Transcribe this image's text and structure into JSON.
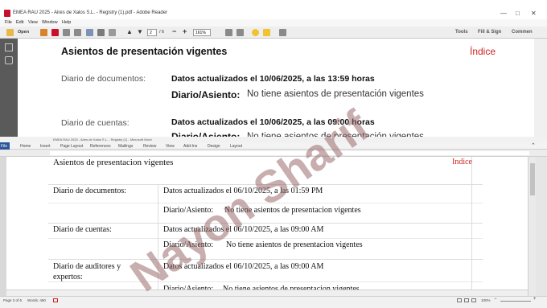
{
  "reader": {
    "title": "EMEA RAU 2025 - Aires de Xalos S.L. - Registry (1).pdf - Adobe Reader",
    "menu": [
      "File",
      "Edit",
      "View",
      "Window",
      "Help"
    ],
    "toolbar": {
      "open_label": "Open",
      "page_current": "2",
      "page_total": "/ 6",
      "zoom": "161%",
      "right_items": [
        "Tools",
        "Fill & Sign",
        "Commen"
      ]
    },
    "page": {
      "title": "Asientos de presentación vigentes",
      "index_link": "Índice",
      "row1_label": "Diario de documentos:",
      "row1_updated": "Datos actualizados el 10/06/2025, a las 13:59 horas",
      "row1_diario": "Diario/Asiento:",
      "row1_status": "No tiene asientos de presentación vigentes",
      "row2_label": "Diario de cuentas:",
      "row2_updated": "Datos actualizados el 10/06/2025, a las 09:00 horas",
      "row2_diario": "Diario/Asiento:",
      "row2_status": "No tiene asientos de presentación vigentes"
    }
  },
  "word": {
    "title_left": "EMEA RAU 2025 - Aires de Xalos S.L. - Registry (1) - Microsoft Word",
    "ribbon": [
      "File",
      "Home",
      "Insert",
      "Page Layout",
      "References",
      "Mailings",
      "Review",
      "View",
      "Add-Ins",
      "Design",
      "Layout"
    ],
    "doc": {
      "title": "Asientos de presentacion vigentes",
      "index_link": "Indice",
      "row1_label": "Diario de documentos:",
      "row1_updated": "Datos actualizados el 06/10/2025, a las 01:59 PM",
      "row1_diario": "Diario/Asiento:",
      "row1_status": "No tiene asientos de presentacion vigentes",
      "row2_label": "Diario de cuentas:",
      "row2_updated": "Datos actualizados el 06/10/2025, a las 09:00 AM",
      "row2_diario": "Diario/Asiento:",
      "row2_status": "No tiene asientos de presentacion vigentes",
      "row3_label_line1": "Diario de auditores y",
      "row3_label_line2": "expertos:",
      "row3_updated": "Datos actualizados el 06/10/2025, a las 09:00 AM",
      "row3_diario": "Diario/Asiento:",
      "row3_status": "No tiene asientos de presentacion vigentes"
    },
    "status": {
      "page": "Page 3 of 6",
      "words": "Words: 460",
      "zoom": "100%"
    }
  },
  "watermark": "Nayon Sharif",
  "colors": {
    "adobe_red": "#c8102e",
    "link_red": "#cc2222",
    "word_blue": "#2b579a",
    "watermark": "#966464"
  }
}
